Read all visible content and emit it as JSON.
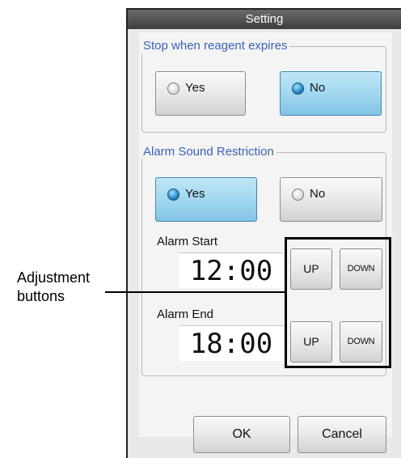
{
  "dialog": {
    "title": "Setting",
    "ok_label": "OK",
    "cancel_label": "Cancel"
  },
  "stop_group": {
    "title": "Stop when reagent expires",
    "yes_label": "Yes",
    "no_label": "No",
    "selected": "No"
  },
  "alarm_group": {
    "title": "Alarm Sound Restriction",
    "yes_label": "Yes",
    "no_label": "No",
    "selected": "Yes",
    "start_label": "Alarm Start",
    "start_time": "12:00",
    "end_label": "Alarm End",
    "end_time": "18:00",
    "up_label": "UP",
    "down_label": "DOWN"
  },
  "callout": {
    "line1": "Adjustment",
    "line2": "buttons"
  }
}
